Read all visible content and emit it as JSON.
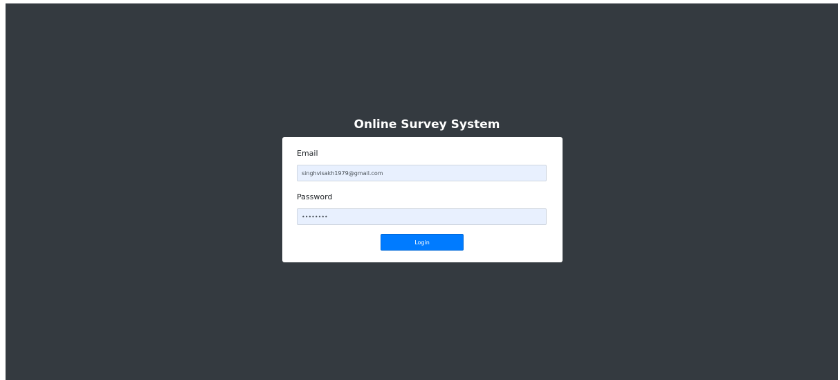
{
  "app": {
    "title": "Online Survey System"
  },
  "form": {
    "email_label": "Email",
    "email_value": "singhvisakh1979@gmail.com",
    "password_label": "Password",
    "password_value": "********",
    "login_label": "Login"
  },
  "colors": {
    "page_background": "#343a40",
    "card_background": "#ffffff",
    "input_fill": "#e8f0fe",
    "button_primary": "#007bff"
  }
}
